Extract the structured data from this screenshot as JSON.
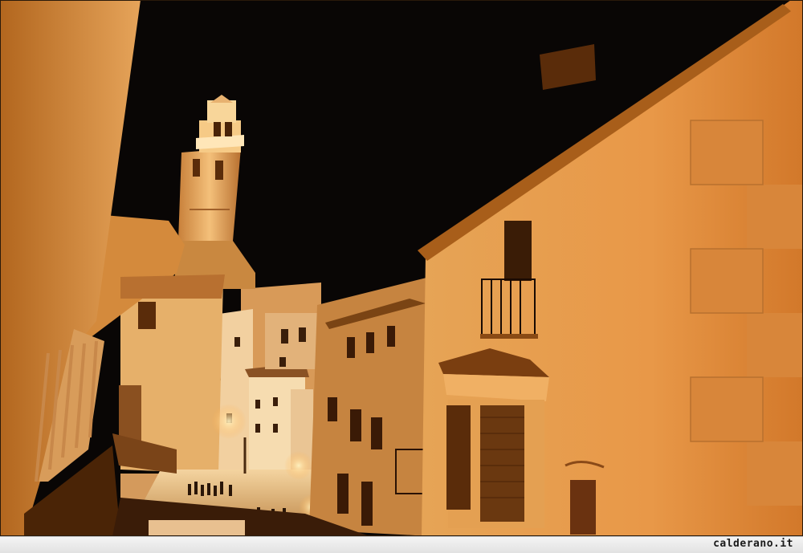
{
  "image": {
    "subject": "night-street-scene-with-bell-tower",
    "colors": {
      "sky": "#080505",
      "wall_lit": "#e8a050",
      "wall_bright": "#f4c078",
      "wall_shadow": "#7a4414",
      "tower": "#f0b060",
      "window": "#1a0c04"
    }
  },
  "caption": {
    "watermark": "calderano.it"
  }
}
